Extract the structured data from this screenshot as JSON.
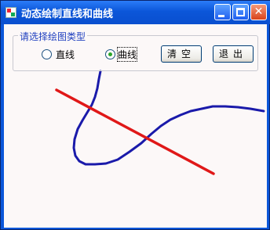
{
  "window": {
    "title": "动态绘制直线和曲线"
  },
  "group": {
    "title": "请选择绘图类型",
    "options": [
      {
        "label": "直线",
        "selected": false
      },
      {
        "label": "曲线",
        "selected": true
      }
    ]
  },
  "buttons": {
    "clear": "清空",
    "exit": "退出"
  },
  "colors": {
    "line": "#e01818",
    "curve": "#1a1aaa"
  }
}
